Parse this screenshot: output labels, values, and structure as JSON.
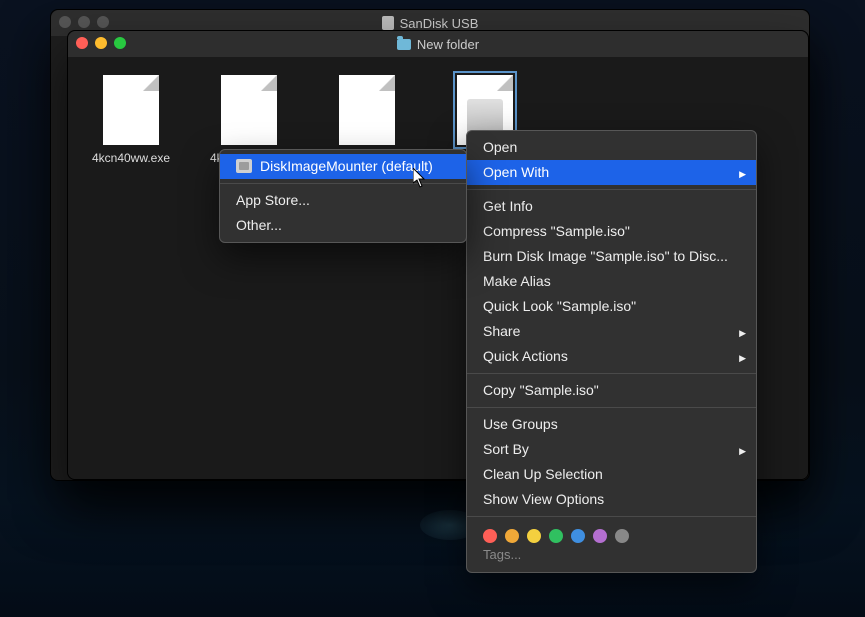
{
  "back_window": {
    "title": "SanDisk USB"
  },
  "front_window": {
    "title": "New folder",
    "files": [
      {
        "label": "4kcn40ww.exe",
        "kind": "doc"
      },
      {
        "label": "4kcn40ww.exe",
        "kind": "doc"
      },
      {
        "label": "",
        "kind": "doc"
      },
      {
        "label": "",
        "kind": "iso"
      }
    ]
  },
  "context_menu": {
    "items": [
      {
        "label": "Open"
      },
      {
        "label": "Open With",
        "submenu": true,
        "highlighted": true
      },
      null,
      {
        "label": "Get Info"
      },
      {
        "label": "Compress \"Sample.iso\""
      },
      {
        "label": "Burn Disk Image \"Sample.iso\" to Disc..."
      },
      {
        "label": "Make Alias"
      },
      {
        "label": "Quick Look \"Sample.iso\""
      },
      {
        "label": "Share",
        "submenu": true
      },
      {
        "label": "Quick Actions",
        "submenu": true
      },
      null,
      {
        "label": "Copy \"Sample.iso\""
      },
      null,
      {
        "label": "Use Groups"
      },
      {
        "label": "Sort By",
        "submenu": true
      },
      {
        "label": "Clean Up Selection"
      },
      {
        "label": "Show View Options"
      }
    ],
    "tags_label": "Tags...",
    "tag_colors": [
      "#ff5f57",
      "#f0a838",
      "#f4d03f",
      "#30c060",
      "#3f8fe0",
      "#b46fd0",
      "#888888"
    ]
  },
  "openwith_submenu": {
    "items": [
      {
        "label": "DiskImageMounter (default)",
        "icon": "disk-image-mounter-icon",
        "highlighted": true
      },
      null,
      {
        "label": "App Store..."
      },
      {
        "label": "Other..."
      }
    ]
  }
}
